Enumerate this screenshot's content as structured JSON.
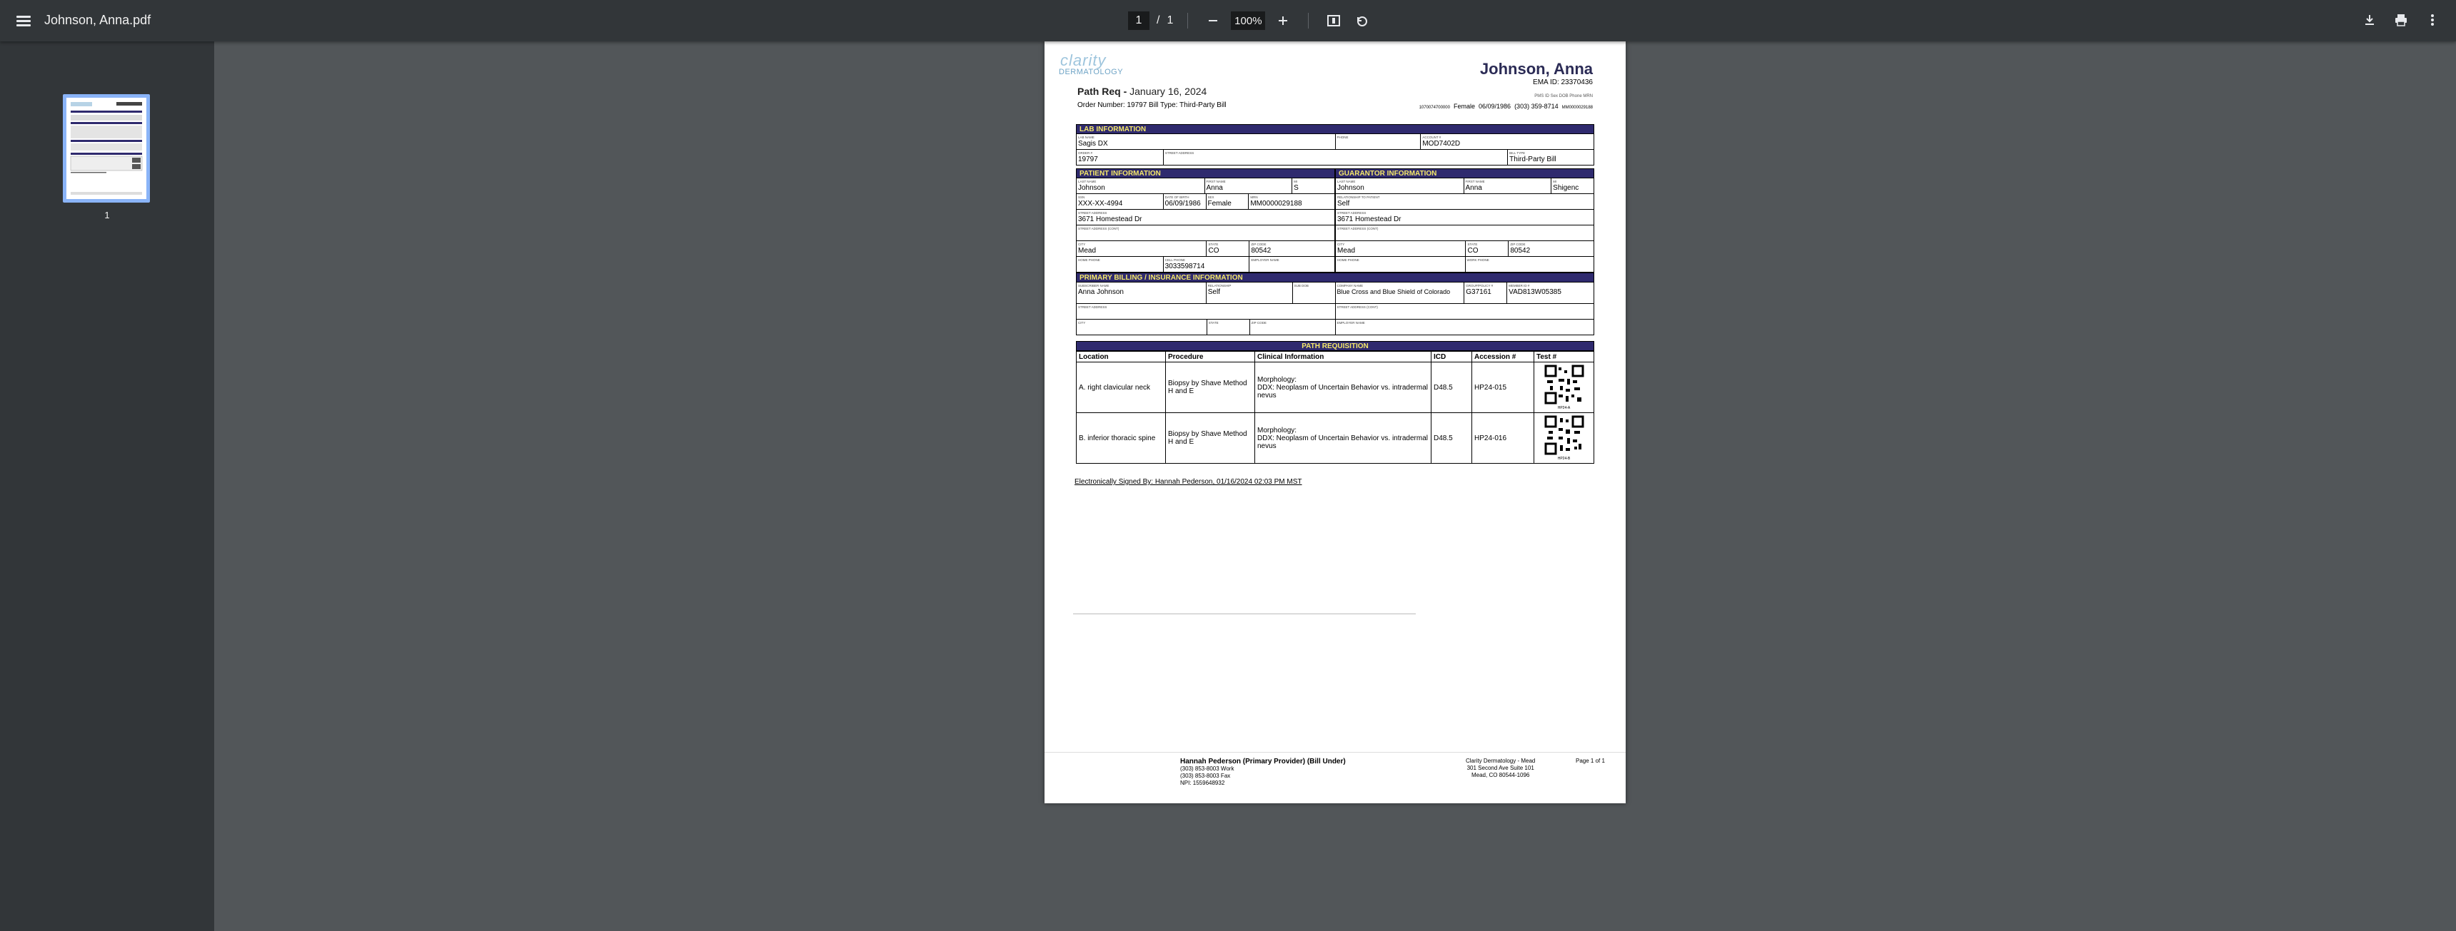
{
  "toolbar": {
    "title": "Johnson, Anna.pdf",
    "page_current": "1",
    "page_sep": "/",
    "page_total": "1",
    "zoom": "100%"
  },
  "sidebar": {
    "thumbnail_label": "1"
  },
  "doc": {
    "logo_top": "clarity",
    "logo_bottom": "DERMATOLOGY",
    "title_prefix": "Path Req - ",
    "title_date": "January 16, 2024",
    "order_line": "Order Number: 19797  Bill Type: Third-Party Bill",
    "patient_name": "Johnson, Anna",
    "ema_id": "EMA ID: 23370436",
    "header_labels": "PMS ID     Sex     DOB     Phone     MRN",
    "pms_id": "1070074700000",
    "sex": "Female",
    "dob": "06/09/1986",
    "phone": "(303) 359-8714",
    "mrn": "MM0000029188",
    "lab_info": {
      "header": "LAB INFORMATION",
      "lab_name_label": "LAB NAME",
      "lab_name": "Sagis DX",
      "phone_label": "PHONE",
      "account_label": "ACCOUNT #",
      "account": "MOD7402D",
      "order_label": "ORDER #",
      "order": "19797",
      "street_label": "STREET ADDRESS",
      "bill_type_label": "BILL TYPE",
      "bill_type": "Third-Party Bill"
    },
    "patient_info": {
      "header": "PATIENT INFORMATION",
      "last_name": "Johnson",
      "first_name": "Anna",
      "mi": "S",
      "ssn": "XXX-XX-4994",
      "dob": "06/09/1986",
      "sex": "Female",
      "mrn": "MM0000029188",
      "street": "3671 Homestead Dr",
      "city": "Mead",
      "state": "CO",
      "zip": "80542",
      "cell_phone": "3033598714",
      "labels": {
        "last_name": "LAST NAME",
        "first_name": "FIRST NAME",
        "mi": "MI",
        "ssn": "SSN",
        "dob": "DATE OF BIRTH",
        "sex": "SEX",
        "mrn": "MRN",
        "street": "STREET ADDRESS",
        "street2": "STREET ADDRESS (CONT)",
        "city": "CITY",
        "state": "STATE",
        "zip": "ZIP CODE",
        "home_phone": "HOME PHONE",
        "cell_phone": "CELL PHONE",
        "employer": "EMPLOYER NAME"
      }
    },
    "guarantor_info": {
      "header": "GUARANTOR INFORMATION",
      "last_name": "Johnson",
      "first_name": "Anna",
      "suffix": "Shigenc",
      "relationship": "Self",
      "street": "3671 Homestead Dr",
      "city": "Mead",
      "state": "CO",
      "zip": "80542",
      "labels": {
        "last_name": "LAST NAME",
        "first_name": "FIRST NAME",
        "mi": "MI",
        "relationship": "RELATIONSHIP TO PATIENT",
        "street": "STREET ADDRESS",
        "street2": "STREET ADDRESS (CONT)",
        "city": "CITY",
        "state": "STATE",
        "zip": "ZIP CODE",
        "home_phone": "HOME PHONE",
        "work_phone": "WORK PHONE"
      }
    },
    "billing_info": {
      "header": "PRIMARY BILLING / INSURANCE INFORMATION",
      "subscriber": "Anna Johnson",
      "relationship": "Self",
      "company": "Blue Cross and Blue Shield of Colorado",
      "group": "G37161",
      "member": "VAD813W05385",
      "labels": {
        "subscriber": "SUBSCRIBER NAME",
        "relationship": "RELATIONSHIP",
        "sub_dob": "SUB DOB",
        "company": "COMPANY NAME",
        "group": "GROUP/POLICY #",
        "member": "MEMBER ID #",
        "street": "STREET ADDRESS",
        "street2": "STREET ADDRESS (CONT)",
        "city": "CITY",
        "state": "STATE",
        "zip": "ZIP CODE",
        "employer": "EMPLOYER NAME"
      }
    },
    "requisition": {
      "header": "PATH REQUISITION",
      "columns": [
        "Location",
        "Procedure",
        "Clinical Information",
        "ICD",
        "Accession #",
        "Test #"
      ],
      "rows": [
        {
          "location": "A. right clavicular neck",
          "procedure": "Biopsy by Shave Method H and E",
          "clinical": "Morphology:\nDDX: Neoplasm of Uncertain Behavior vs. intradermal nevus",
          "icd": "D48.5",
          "accession": "HP24-015",
          "test": "HP24-A"
        },
        {
          "location": "B. inferior thoracic spine",
          "procedure": "Biopsy by Shave Method H and E",
          "clinical": "Morphology:\nDDX: Neoplasm of Uncertain Behavior vs. intradermal nevus",
          "icd": "D48.5",
          "accession": "HP24-016",
          "test": "HP24-B"
        }
      ]
    },
    "signed": "Electronically Signed By: Hannah Pederson, 01/16/2024 02:03 PM MST",
    "footer": {
      "provider": "Hannah Pederson (Primary Provider) (Bill Under)",
      "work": "(303) 853-8003 Work",
      "fax": "(303) 853-8003 Fax",
      "npi": "NPI: 1559648932",
      "clinic": "Clarity Dermatology - Mead",
      "address1": "301 Second Ave Suite 101",
      "address2": "Mead, CO 80544-1096",
      "page": "Page 1 of 1"
    }
  },
  "colors": {
    "toolbar_bg": "#323639",
    "viewer_bg": "#525659",
    "section_header_bg": "#2f2a6e",
    "section_header_text": "#f5e86a",
    "thumb_border": "#8ab4f8"
  },
  "icons": [
    "menu-icon",
    "zoom-out-icon",
    "zoom-in-icon",
    "fit-page-icon",
    "rotate-icon",
    "download-icon",
    "print-icon",
    "more-vert-icon"
  ]
}
